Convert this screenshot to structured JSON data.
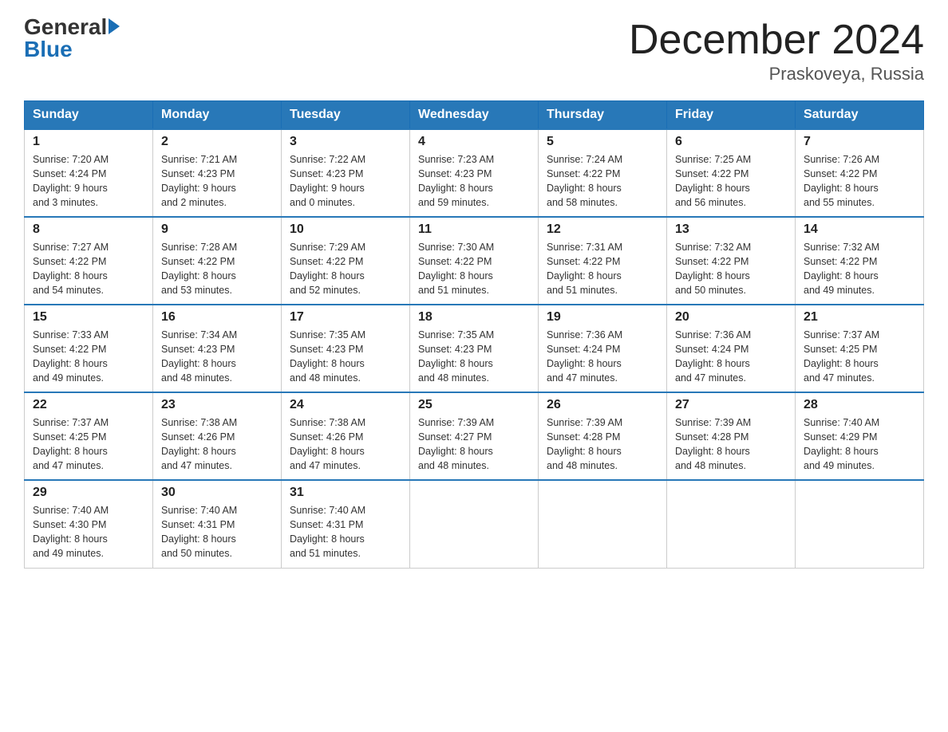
{
  "header": {
    "logo": {
      "general": "General",
      "blue": "Blue"
    },
    "title": "December 2024",
    "location": "Praskoveya, Russia"
  },
  "days_of_week": [
    "Sunday",
    "Monday",
    "Tuesday",
    "Wednesday",
    "Thursday",
    "Friday",
    "Saturday"
  ],
  "weeks": [
    [
      {
        "day": "1",
        "sunrise": "Sunrise: 7:20 AM",
        "sunset": "Sunset: 4:24 PM",
        "daylight": "Daylight: 9 hours",
        "daylight2": "and 3 minutes."
      },
      {
        "day": "2",
        "sunrise": "Sunrise: 7:21 AM",
        "sunset": "Sunset: 4:23 PM",
        "daylight": "Daylight: 9 hours",
        "daylight2": "and 2 minutes."
      },
      {
        "day": "3",
        "sunrise": "Sunrise: 7:22 AM",
        "sunset": "Sunset: 4:23 PM",
        "daylight": "Daylight: 9 hours",
        "daylight2": "and 0 minutes."
      },
      {
        "day": "4",
        "sunrise": "Sunrise: 7:23 AM",
        "sunset": "Sunset: 4:23 PM",
        "daylight": "Daylight: 8 hours",
        "daylight2": "and 59 minutes."
      },
      {
        "day": "5",
        "sunrise": "Sunrise: 7:24 AM",
        "sunset": "Sunset: 4:22 PM",
        "daylight": "Daylight: 8 hours",
        "daylight2": "and 58 minutes."
      },
      {
        "day": "6",
        "sunrise": "Sunrise: 7:25 AM",
        "sunset": "Sunset: 4:22 PM",
        "daylight": "Daylight: 8 hours",
        "daylight2": "and 56 minutes."
      },
      {
        "day": "7",
        "sunrise": "Sunrise: 7:26 AM",
        "sunset": "Sunset: 4:22 PM",
        "daylight": "Daylight: 8 hours",
        "daylight2": "and 55 minutes."
      }
    ],
    [
      {
        "day": "8",
        "sunrise": "Sunrise: 7:27 AM",
        "sunset": "Sunset: 4:22 PM",
        "daylight": "Daylight: 8 hours",
        "daylight2": "and 54 minutes."
      },
      {
        "day": "9",
        "sunrise": "Sunrise: 7:28 AM",
        "sunset": "Sunset: 4:22 PM",
        "daylight": "Daylight: 8 hours",
        "daylight2": "and 53 minutes."
      },
      {
        "day": "10",
        "sunrise": "Sunrise: 7:29 AM",
        "sunset": "Sunset: 4:22 PM",
        "daylight": "Daylight: 8 hours",
        "daylight2": "and 52 minutes."
      },
      {
        "day": "11",
        "sunrise": "Sunrise: 7:30 AM",
        "sunset": "Sunset: 4:22 PM",
        "daylight": "Daylight: 8 hours",
        "daylight2": "and 51 minutes."
      },
      {
        "day": "12",
        "sunrise": "Sunrise: 7:31 AM",
        "sunset": "Sunset: 4:22 PM",
        "daylight": "Daylight: 8 hours",
        "daylight2": "and 51 minutes."
      },
      {
        "day": "13",
        "sunrise": "Sunrise: 7:32 AM",
        "sunset": "Sunset: 4:22 PM",
        "daylight": "Daylight: 8 hours",
        "daylight2": "and 50 minutes."
      },
      {
        "day": "14",
        "sunrise": "Sunrise: 7:32 AM",
        "sunset": "Sunset: 4:22 PM",
        "daylight": "Daylight: 8 hours",
        "daylight2": "and 49 minutes."
      }
    ],
    [
      {
        "day": "15",
        "sunrise": "Sunrise: 7:33 AM",
        "sunset": "Sunset: 4:22 PM",
        "daylight": "Daylight: 8 hours",
        "daylight2": "and 49 minutes."
      },
      {
        "day": "16",
        "sunrise": "Sunrise: 7:34 AM",
        "sunset": "Sunset: 4:23 PM",
        "daylight": "Daylight: 8 hours",
        "daylight2": "and 48 minutes."
      },
      {
        "day": "17",
        "sunrise": "Sunrise: 7:35 AM",
        "sunset": "Sunset: 4:23 PM",
        "daylight": "Daylight: 8 hours",
        "daylight2": "and 48 minutes."
      },
      {
        "day": "18",
        "sunrise": "Sunrise: 7:35 AM",
        "sunset": "Sunset: 4:23 PM",
        "daylight": "Daylight: 8 hours",
        "daylight2": "and 48 minutes."
      },
      {
        "day": "19",
        "sunrise": "Sunrise: 7:36 AM",
        "sunset": "Sunset: 4:24 PM",
        "daylight": "Daylight: 8 hours",
        "daylight2": "and 47 minutes."
      },
      {
        "day": "20",
        "sunrise": "Sunrise: 7:36 AM",
        "sunset": "Sunset: 4:24 PM",
        "daylight": "Daylight: 8 hours",
        "daylight2": "and 47 minutes."
      },
      {
        "day": "21",
        "sunrise": "Sunrise: 7:37 AM",
        "sunset": "Sunset: 4:25 PM",
        "daylight": "Daylight: 8 hours",
        "daylight2": "and 47 minutes."
      }
    ],
    [
      {
        "day": "22",
        "sunrise": "Sunrise: 7:37 AM",
        "sunset": "Sunset: 4:25 PM",
        "daylight": "Daylight: 8 hours",
        "daylight2": "and 47 minutes."
      },
      {
        "day": "23",
        "sunrise": "Sunrise: 7:38 AM",
        "sunset": "Sunset: 4:26 PM",
        "daylight": "Daylight: 8 hours",
        "daylight2": "and 47 minutes."
      },
      {
        "day": "24",
        "sunrise": "Sunrise: 7:38 AM",
        "sunset": "Sunset: 4:26 PM",
        "daylight": "Daylight: 8 hours",
        "daylight2": "and 47 minutes."
      },
      {
        "day": "25",
        "sunrise": "Sunrise: 7:39 AM",
        "sunset": "Sunset: 4:27 PM",
        "daylight": "Daylight: 8 hours",
        "daylight2": "and 48 minutes."
      },
      {
        "day": "26",
        "sunrise": "Sunrise: 7:39 AM",
        "sunset": "Sunset: 4:28 PM",
        "daylight": "Daylight: 8 hours",
        "daylight2": "and 48 minutes."
      },
      {
        "day": "27",
        "sunrise": "Sunrise: 7:39 AM",
        "sunset": "Sunset: 4:28 PM",
        "daylight": "Daylight: 8 hours",
        "daylight2": "and 48 minutes."
      },
      {
        "day": "28",
        "sunrise": "Sunrise: 7:40 AM",
        "sunset": "Sunset: 4:29 PM",
        "daylight": "Daylight: 8 hours",
        "daylight2": "and 49 minutes."
      }
    ],
    [
      {
        "day": "29",
        "sunrise": "Sunrise: 7:40 AM",
        "sunset": "Sunset: 4:30 PM",
        "daylight": "Daylight: 8 hours",
        "daylight2": "and 49 minutes."
      },
      {
        "day": "30",
        "sunrise": "Sunrise: 7:40 AM",
        "sunset": "Sunset: 4:31 PM",
        "daylight": "Daylight: 8 hours",
        "daylight2": "and 50 minutes."
      },
      {
        "day": "31",
        "sunrise": "Sunrise: 7:40 AM",
        "sunset": "Sunset: 4:31 PM",
        "daylight": "Daylight: 8 hours",
        "daylight2": "and 51 minutes."
      },
      null,
      null,
      null,
      null
    ]
  ]
}
